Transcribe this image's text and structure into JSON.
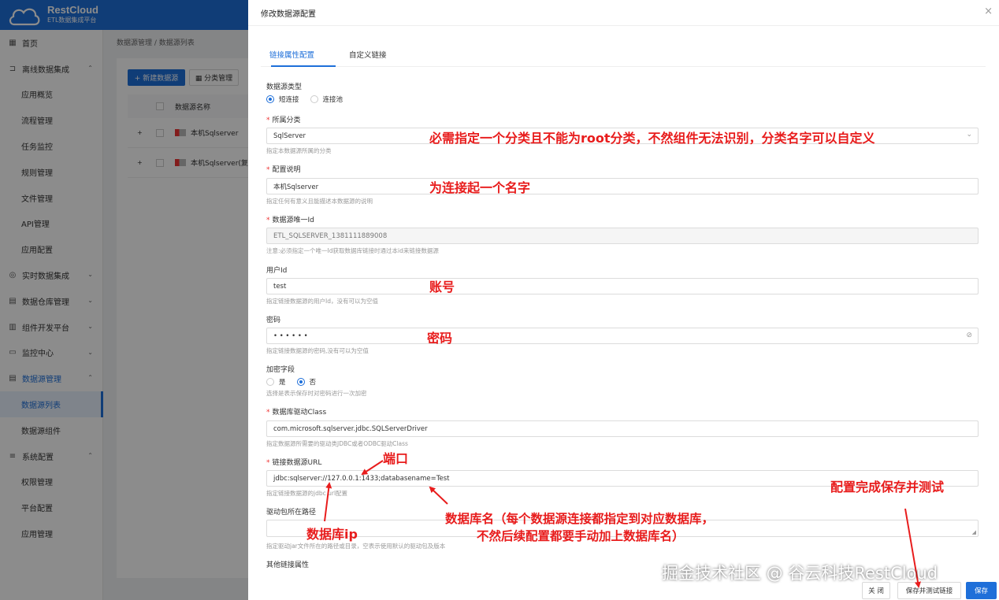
{
  "app": {
    "logo_title": "RestCloud",
    "logo_subtitle": "ETL数据集成平台"
  },
  "sidebar": {
    "items": [
      {
        "label": "首页",
        "icon": "grid-icon",
        "glyph": "▦",
        "level": "top"
      },
      {
        "label": "离线数据集成",
        "icon": "offline-icon",
        "glyph": "⊐",
        "level": "top",
        "chevron": "⌃"
      },
      {
        "label": "应用概览",
        "level": "sub"
      },
      {
        "label": "流程管理",
        "level": "sub"
      },
      {
        "label": "任务监控",
        "level": "sub"
      },
      {
        "label": "规则管理",
        "level": "sub"
      },
      {
        "label": "文件管理",
        "level": "sub"
      },
      {
        "label": "API管理",
        "level": "sub"
      },
      {
        "label": "应用配置",
        "level": "sub"
      },
      {
        "label": "实时数据集成",
        "icon": "realtime-icon",
        "glyph": "◎",
        "level": "top",
        "chevron": "⌄"
      },
      {
        "label": "数据仓库管理",
        "icon": "warehouse-icon",
        "glyph": "▤",
        "level": "top",
        "chevron": "⌄"
      },
      {
        "label": "组件开发平台",
        "icon": "component-icon",
        "glyph": "▥",
        "level": "top",
        "chevron": "⌄"
      },
      {
        "label": "监控中心",
        "icon": "monitor-icon",
        "glyph": "▭",
        "level": "top",
        "chevron": "⌄"
      },
      {
        "label": "数据源管理",
        "icon": "datasource-icon",
        "glyph": "▤",
        "level": "top",
        "chevron": "⌃",
        "group_active": true
      },
      {
        "label": "数据源列表",
        "level": "sub",
        "active": true
      },
      {
        "label": "数据源组件",
        "level": "sub"
      },
      {
        "label": "系统配置",
        "icon": "settings-icon",
        "glyph": "≡",
        "level": "top",
        "chevron": "⌃"
      },
      {
        "label": "权限管理",
        "level": "sub"
      },
      {
        "label": "平台配置",
        "level": "sub"
      },
      {
        "label": "应用管理",
        "level": "sub"
      }
    ]
  },
  "breadcrumb": "数据源管理  /  数据源列表",
  "list": {
    "new_button": "+ 新建数据源",
    "category_button": "▦ 分类管理",
    "column_name": "数据源名称",
    "rows": [
      "本机Sqlserver",
      "本机Sqlserver(复制"
    ]
  },
  "drawer": {
    "title": "修改数据源配置",
    "close": "×",
    "tabs": [
      "链接属性配置",
      "自定义链接"
    ],
    "conn_type": {
      "label": "数据源类型",
      "options": [
        "短连接",
        "连接池"
      ],
      "selected": 0
    },
    "category": {
      "label": "所属分类",
      "value": "SqlServer",
      "help": "指定本数据源所属的分类"
    },
    "config_desc": {
      "label": "配置说明",
      "value": "本机Sqlserver",
      "help": "指定任何有意义且能描述本数据源的说明"
    },
    "unique_id": {
      "label": "数据源唯一Id",
      "value": "ETL_SQLSERVER_1381111889008",
      "help": "注意:必须指定一个唯一Id获取数据库链接时通过本id来链接数据源"
    },
    "user_id": {
      "label": "用户Id",
      "value": "test",
      "help": "指定链接数据源的用户Id，没有可以为空值"
    },
    "password": {
      "label": "密码",
      "value": "• • • • • •",
      "help": "指定链接数据源的密码,没有可以为空值"
    },
    "encrypt": {
      "label": "加密字段",
      "options": [
        "是",
        "否"
      ],
      "selected": 1,
      "help": "选择是表示保存时对密码进行一次加密"
    },
    "driver_class": {
      "label": "数据库驱动Class",
      "value": "com.microsoft.sqlserver.jdbc.SQLServerDriver",
      "help": "指定数据源所需要的驱动类JDBC或者ODBC驱动Class"
    },
    "url": {
      "label": "链接数据源URL",
      "value": "jdbc:sqlserver://127.0.0.1:1433;databasename=Test",
      "help": "指定链接数据源的jdbc url配置"
    },
    "driver_path": {
      "label": "驱动包所在路径",
      "value": "",
      "help": "指定驱动jar文件所在的路径或目录，空表示使用默认的驱动包及版本"
    },
    "other_props": {
      "label": "其他链接属性"
    },
    "footer": {
      "close": "关 闭",
      "save_test": "保存并测试链接",
      "save": "保存"
    }
  },
  "annotations": {
    "category": "必需指定一个分类且不能为root分类，不然组件无法识别，分类名字可以自定义",
    "name": "为连接起一个名字",
    "account": "账号",
    "password": "密码",
    "port": "端口",
    "db_ip": "数据库ip",
    "db_name_line1": "数据库名（每个数据源连接都指定到对应数据库，",
    "db_name_line2": "不然后续配置都要手动加上数据库名）",
    "save_test": "配置完成保存并测试"
  },
  "watermark": "掘金技术社区 @ 谷云科技RestCloud",
  "colors": {
    "brand": "#1e6fd9",
    "annotation": "#e81c1c"
  }
}
